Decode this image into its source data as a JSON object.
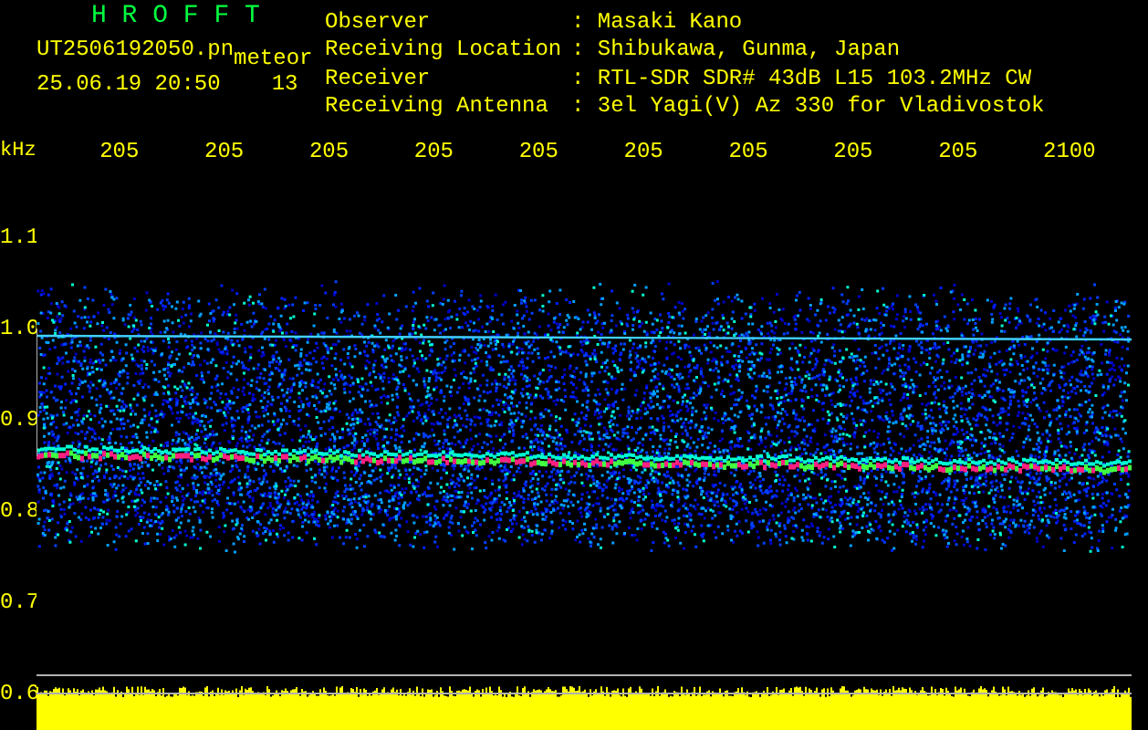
{
  "header": {
    "title": "H R O F F T",
    "file": "UT2506192050.pn",
    "tag": "meteor",
    "timestamp": "25.06.19 20:50",
    "count": "13",
    "info": [
      {
        "label": "Observer",
        "value": ": Masaki Kano"
      },
      {
        "label": "Receiving Location",
        "value": ": Shibukawa, Gunma, Japan"
      },
      {
        "label": "Receiver",
        "value": ": RTL-SDR SDR# 43dB L15 103.2MHz CW"
      },
      {
        "label": "Receiving Antenna",
        "value": ": 3el Yagi(V) Az 330 for Vladivostok"
      }
    ]
  },
  "axis": {
    "unit": "kHz",
    "time_labels": [
      "205",
      "205",
      "205",
      "205",
      "205",
      "205",
      "205",
      "205",
      "205",
      "2100"
    ],
    "freq_labels": [
      "1.1",
      "1.0",
      "0.9",
      "0.8",
      "0.7",
      "0.6"
    ]
  }
}
